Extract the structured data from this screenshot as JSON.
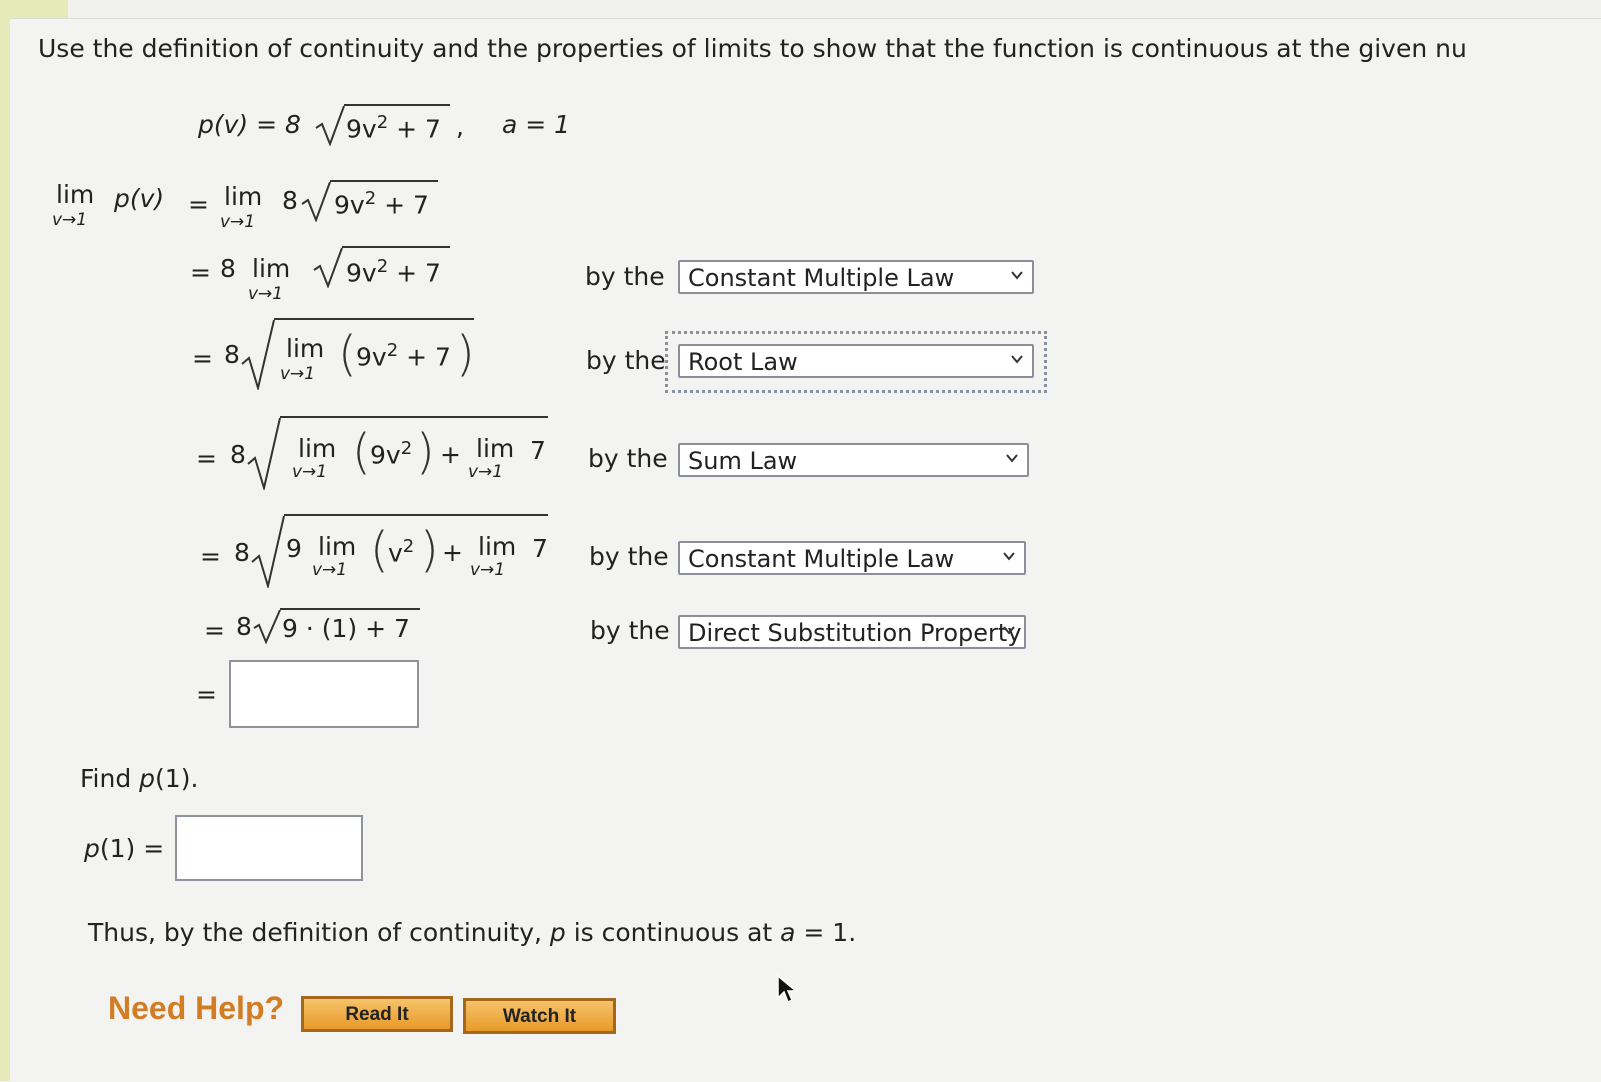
{
  "instruction": "Use the definition of continuity and the properties of limits to show that the function is continuous at the given nu",
  "function_def": {
    "lhs": "p(v) = 8",
    "radicand": "9v",
    "exp": "2",
    "radicand_rest": " + 7",
    "comma": ",",
    "point": "a = 1"
  },
  "limit_notation": {
    "lim": "lim",
    "sub": "v→1"
  },
  "steps": {
    "s0": {
      "lhs_fn": "p(v)",
      "eq": "=",
      "coef": "8",
      "radicand": "9v",
      "exp": "2",
      "rest": " + 7"
    },
    "s1": {
      "eq": "=",
      "coef": "8",
      "radicand": "9v",
      "exp": "2",
      "rest": " + 7",
      "by": "by the",
      "law": "Constant Multiple Law"
    },
    "s2": {
      "eq": "=",
      "coef": "8",
      "inner": "9v",
      "exp": "2",
      "rest": " + 7",
      "by": "by the",
      "law": "Root Law"
    },
    "s3": {
      "eq": "=",
      "coef": "8",
      "inner": "9v",
      "exp": "2",
      "plus": "+",
      "const": "7",
      "by": "by the",
      "law": "Sum Law"
    },
    "s4": {
      "eq": "=",
      "coef": "8",
      "nine": "9",
      "inner": "v",
      "exp": "2",
      "plus": "+",
      "const": "7",
      "by": "by the",
      "law": "Constant Multiple Law"
    },
    "s5": {
      "eq": "=",
      "coef": "8",
      "radicand": "9 · (1) + 7",
      "by": "by the",
      "law": "Direct Substitution Property"
    },
    "s6": {
      "eq": "=",
      "answer": ""
    }
  },
  "find": {
    "prompt_pre": "Find ",
    "prompt_fn": "p",
    "prompt_post": "(1).",
    "label_fn": "p",
    "label_rest": "(1) =",
    "answer": ""
  },
  "conclusion": {
    "pre": "Thus, by the definition of continuity, ",
    "fn": "p",
    "mid": " is continuous at ",
    "var": "a",
    "post": " = 1."
  },
  "help": {
    "title": "Need Help?",
    "read": "Read It",
    "watch": "Watch It"
  }
}
